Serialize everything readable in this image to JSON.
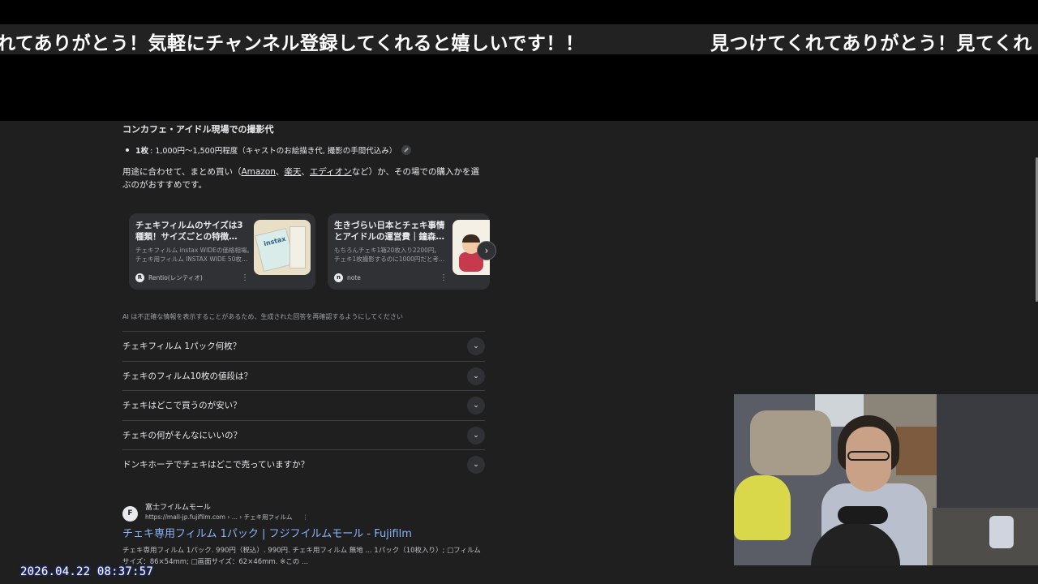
{
  "overlay": {
    "ticker_left": "れてありがとう！気軽にチャンネル登録してくれると嬉しいです！！",
    "ticker_right": "見つけてくれてありがとう！見てくれ",
    "timestamp": "2026.04.22 08:37:57"
  },
  "ai_overview": {
    "heading": "コンカフェ・アイドル現場での撮影代",
    "bullet_bold": "1枚",
    "bullet_text": ": 1,000円〜1,500円程度（キャストのお絵描き代, 撮影の手間代込み）",
    "para_prefix": "用途に合わせて、まとめ買い（",
    "link_amazon": "Amazon",
    "sep1": "、",
    "link_rakuten": "楽天",
    "sep2": "、",
    "link_edion": "エディオン",
    "para_suffix": "など）か、その場での購入かを選ぶのがおすすめです。",
    "disclaimer": "AI は不正確な情報を表示することがあるため、生成された回答を再確認するようにしてください"
  },
  "cards": [
    {
      "title": "チェキフィルムのサイズは3種類！サイズごとの特徴…",
      "snippet_1": "チェキフィルム instax WIDEの価格相場。",
      "snippet_2": "チェキ用フィルム INSTAX WIDE 50枚…",
      "source": "Rentio(レンティオ)",
      "favicon": "R",
      "thumb_label": "instax"
    },
    {
      "title": "生きづらい日本とチェキ事情とアイドルの運営費｜鐘森…",
      "snippet_1": "もちろんチェキ1箱20枚入り2200円。",
      "snippet_2": "チェキ1枚撮影するのに1000円だと考…",
      "source": "note",
      "favicon": "n"
    }
  ],
  "carousel": {
    "next_icon": "›"
  },
  "paa": [
    {
      "q": "チェキフィルム 1パック何枚？"
    },
    {
      "q": "チェキのフィルム10枚の値段は？"
    },
    {
      "q": "チェキはどこで買うのが安い？"
    },
    {
      "q": "チェキの何がそんなにいいの？"
    },
    {
      "q": "ドンキホーテでチェキはどこで売っていますか？"
    }
  ],
  "result": {
    "favicon": "F",
    "site": "富士フイルムモール",
    "url": "https://mall-jp.fujifilm.com › ... › チェキ用フィルム",
    "more": "⋮",
    "title": "チェキ専用フィルム 1パック | フジフイルムモール - Fujifilm",
    "snippet_1": "チェキ専用フィルム 1パック. 990円（税込）. 990円. チェキ用フィルム 無地 ... 1パック（10枚入り）; □フィルムサイズ：86×54mm; □画面サイズ：62×46mm. ※この ..."
  },
  "icons": {
    "chevron": "⌄",
    "card_more": "⋮"
  }
}
